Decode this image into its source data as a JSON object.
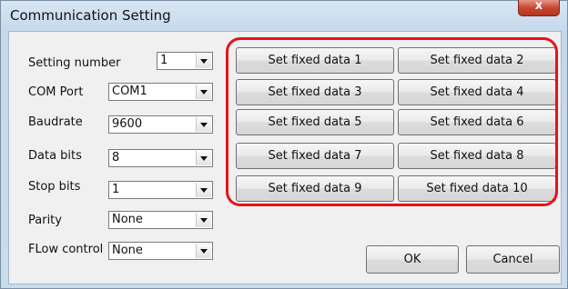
{
  "window": {
    "title": "Communication Setting",
    "close_label": "x"
  },
  "settings": {
    "setting_number": {
      "label": "Setting number",
      "value": "1"
    },
    "com_port": {
      "label": "COM Port",
      "value": "COM1"
    },
    "baudrate": {
      "label": "Baudrate",
      "value": "9600"
    },
    "data_bits": {
      "label": "Data bits",
      "value": "8"
    },
    "stop_bits": {
      "label": "Stop bits",
      "value": "1"
    },
    "parity": {
      "label": "Parity",
      "value": "None"
    },
    "flow_control": {
      "label": "FLow control",
      "value": "None"
    }
  },
  "fixed_data_buttons": [
    "Set fixed data 1",
    "Set fixed data 2",
    "Set fixed data 3",
    "Set fixed data 4",
    "Set fixed data 5",
    "Set fixed data 6",
    "Set fixed data 7",
    "Set fixed data 8",
    "Set fixed data 9",
    "Set fixed data 10"
  ],
  "actions": {
    "ok_label": "OK",
    "cancel_label": "Cancel"
  },
  "colors": {
    "highlight": "#e3141b",
    "client_bg": "#f0f0f0"
  }
}
